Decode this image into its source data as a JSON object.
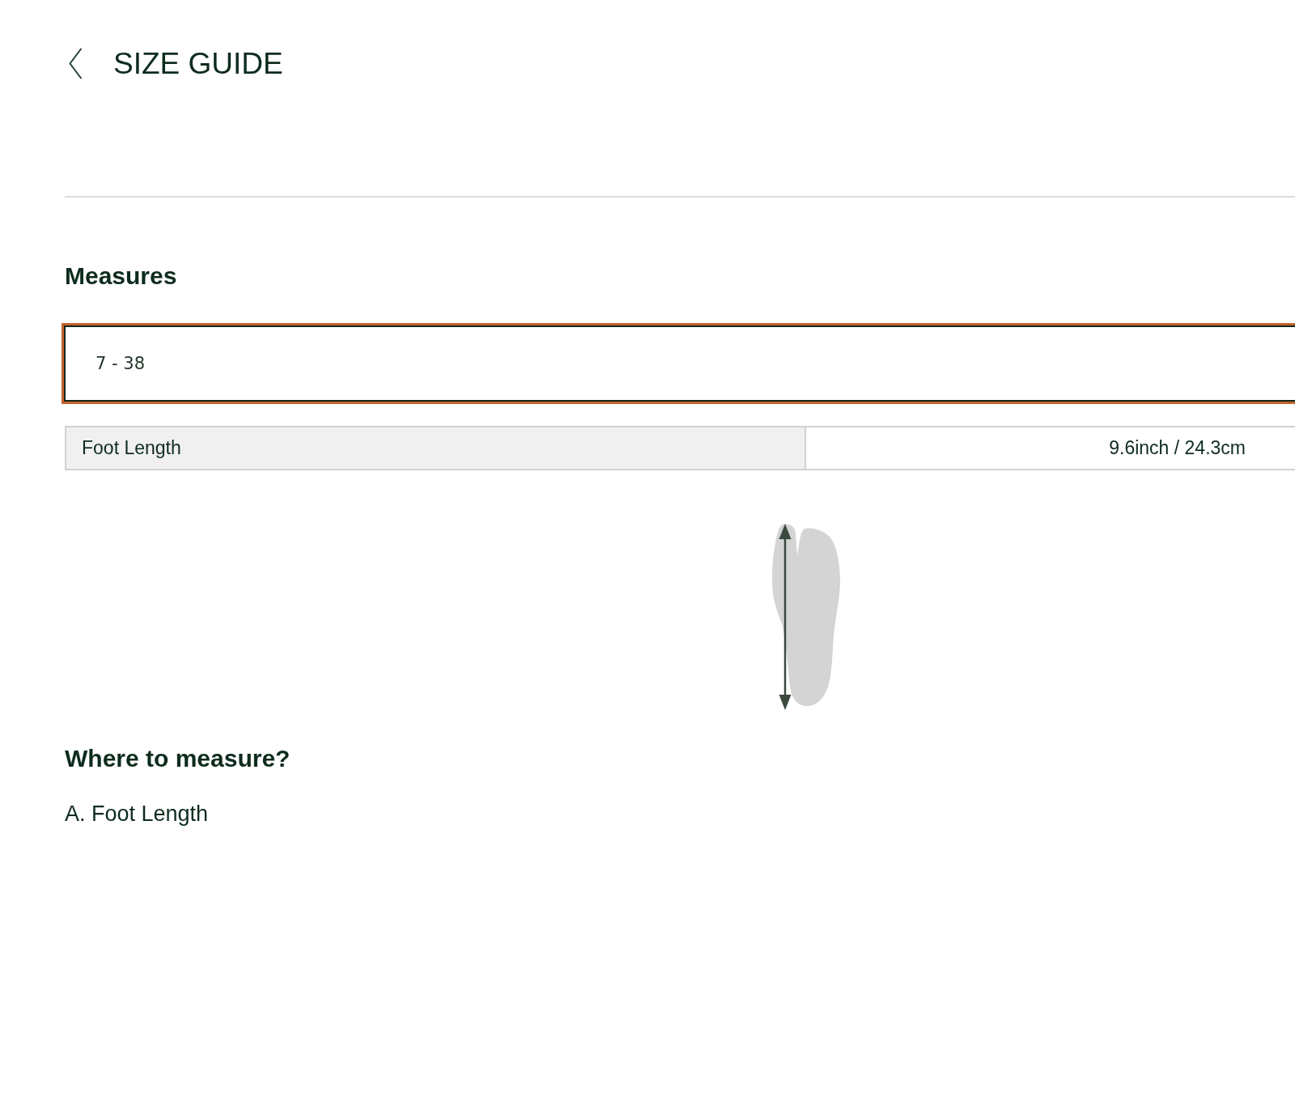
{
  "header": {
    "title": "SIZE GUIDE"
  },
  "measures": {
    "heading": "Measures",
    "size_options": [
      {
        "label": "7 - 38",
        "selected": true
      }
    ],
    "table": {
      "rows": [
        {
          "label": "Foot Length",
          "value": "9.6inch / 24.3cm"
        }
      ]
    }
  },
  "where_to_measure": {
    "heading": "Where to measure?",
    "items": [
      "A. Foot Length"
    ]
  }
}
